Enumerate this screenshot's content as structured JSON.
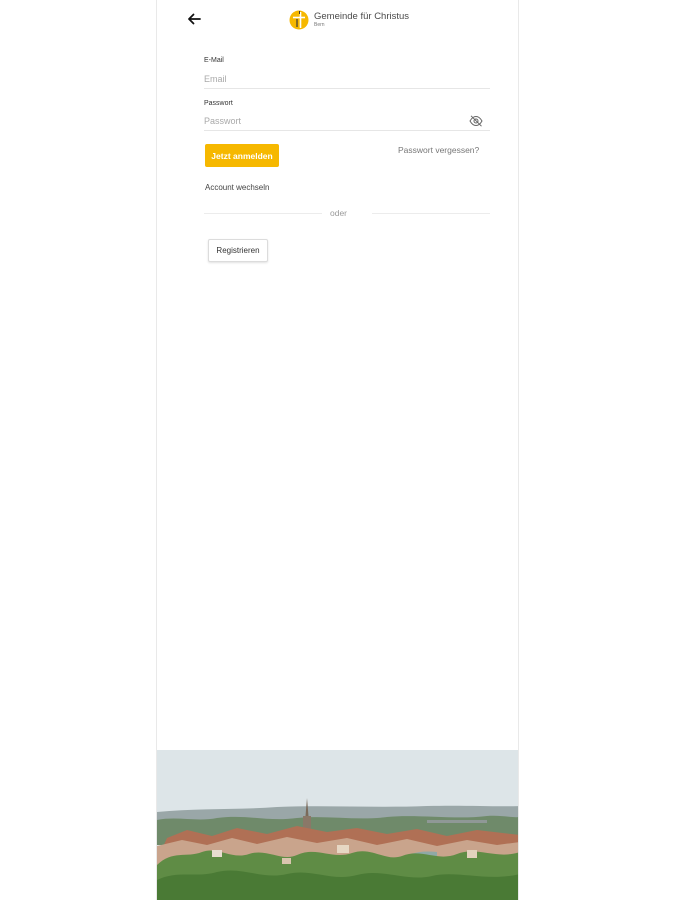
{
  "header": {
    "back_icon": "arrow-left-icon",
    "logo_name": "Gemeinde für Christus",
    "logo_subtitle": "Bern",
    "brand_color": "#f6b800"
  },
  "form": {
    "email_label": "E-Mail",
    "email_placeholder": "Email",
    "email_value": "",
    "password_label": "Passwort",
    "password_placeholder": "Passwort",
    "password_value": "",
    "toggle_visibility_icon": "eye-off-icon",
    "login_button": "Jetzt anmelden",
    "forgot_password": "Passwort vergessen?",
    "switch_account": "Account wechseln",
    "divider_text": "oder",
    "register_button": "Registrieren"
  },
  "footer_image": {
    "subject": "city-panorama"
  }
}
